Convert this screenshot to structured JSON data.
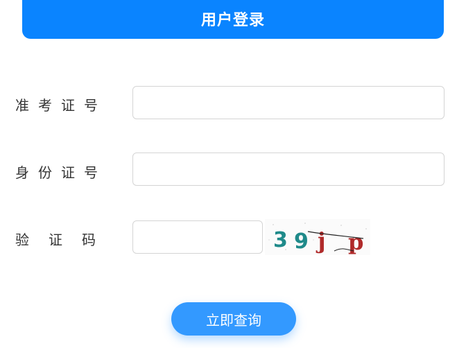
{
  "header": {
    "title": "用户登录"
  },
  "form": {
    "exam_id": {
      "label": "准考证号",
      "value": "",
      "placeholder": ""
    },
    "id_number": {
      "label": "身份证号",
      "value": "",
      "placeholder": ""
    },
    "captcha": {
      "label": "验证码",
      "value": "",
      "placeholder": "",
      "image_text": "39jp"
    }
  },
  "submit": {
    "label": "立即查询"
  },
  "colors": {
    "header_bg": "#0a84ff",
    "button_bg": "#3399ff"
  }
}
